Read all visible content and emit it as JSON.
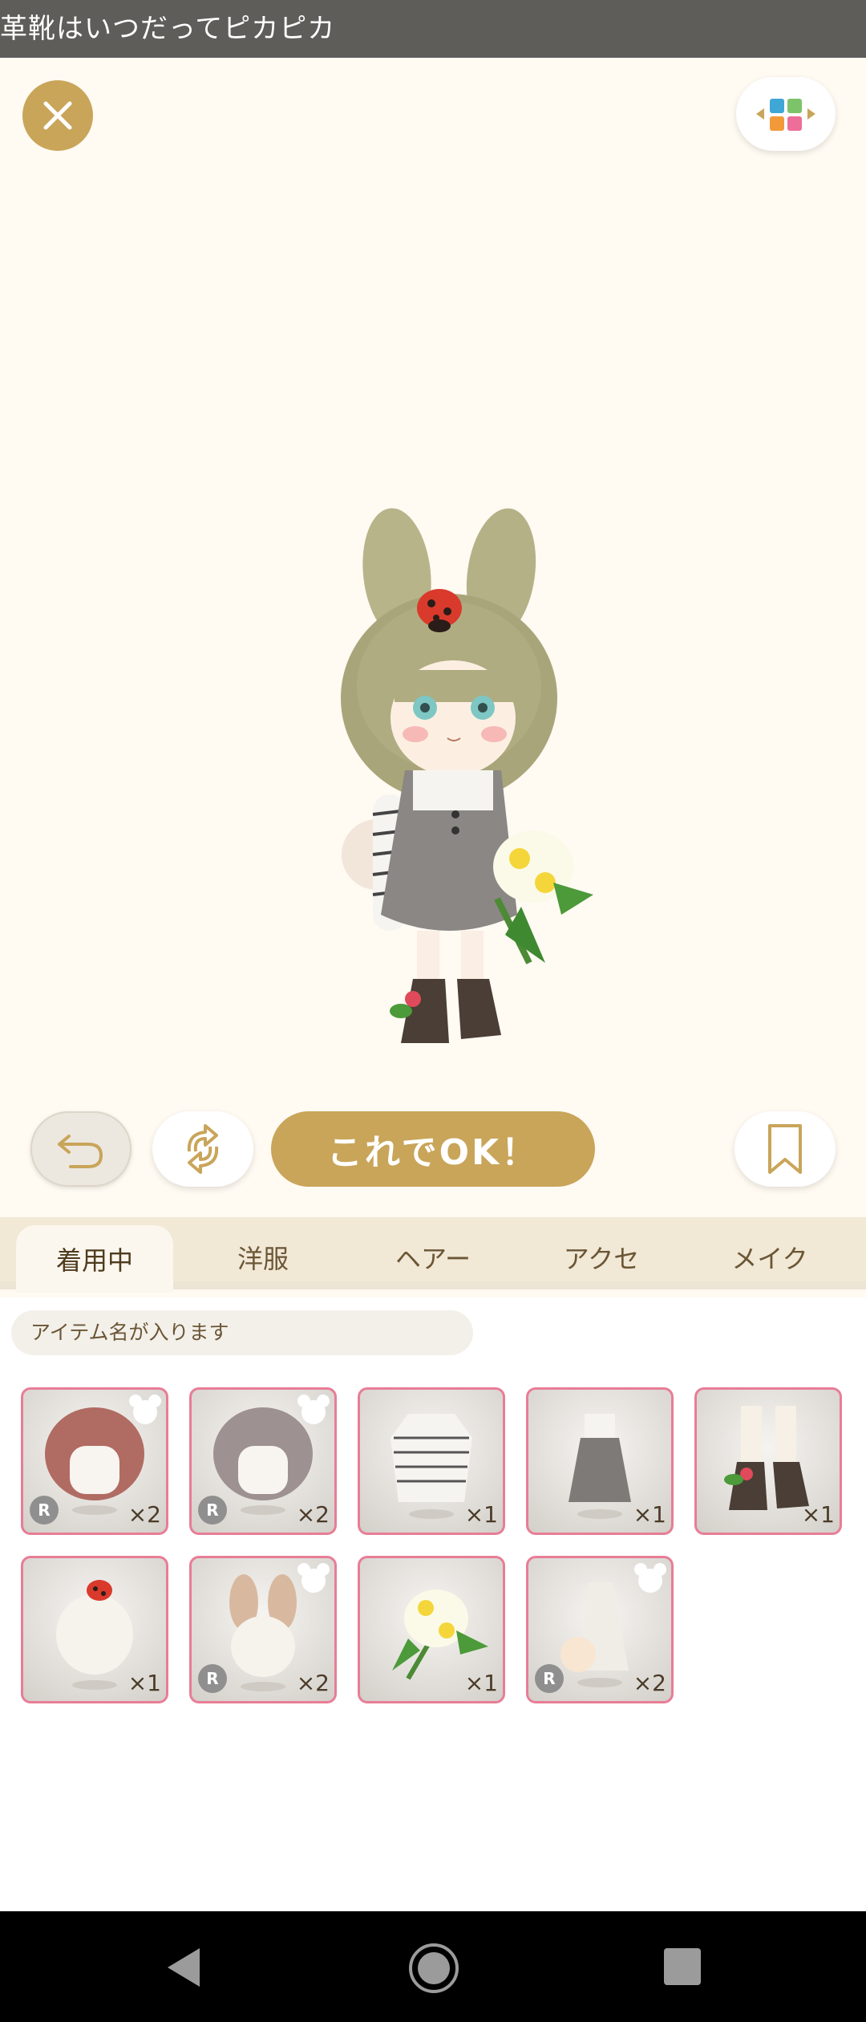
{
  "window": {
    "title": "革靴はいつだってピカピカ"
  },
  "actions": {
    "ok_label": "これでOK！"
  },
  "tabs": [
    {
      "label": "着用中",
      "active": true
    },
    {
      "label": "洋服",
      "active": false
    },
    {
      "label": "ヘアー",
      "active": false
    },
    {
      "label": "アクセ",
      "active": false
    },
    {
      "label": "メイク",
      "active": false
    }
  ],
  "item_name_placeholder": "アイテム名が入ります",
  "items": [
    {
      "name": "hair-red-bob",
      "count": "×2",
      "rarity": "R",
      "bear_badge": true
    },
    {
      "name": "hair-gray-bob",
      "count": "×2",
      "rarity": "R",
      "bear_badge": true
    },
    {
      "name": "striped-shirt",
      "count": "×1",
      "rarity": "",
      "bear_badge": false
    },
    {
      "name": "gray-pinafore-dress",
      "count": "×1",
      "rarity": "",
      "bear_badge": false
    },
    {
      "name": "flower-lace-boots",
      "count": "×1",
      "rarity": "",
      "bear_badge": false
    },
    {
      "name": "ladybug-hair-accessory",
      "count": "×1",
      "rarity": "",
      "bear_badge": false
    },
    {
      "name": "bunny-ears",
      "count": "×2",
      "rarity": "R",
      "bear_badge": true
    },
    {
      "name": "flower-bouquet",
      "count": "×1",
      "rarity": "",
      "bear_badge": false
    },
    {
      "name": "fluffy-tail",
      "count": "×2",
      "rarity": "R",
      "bear_badge": true
    }
  ],
  "colors": {
    "accent_gold": "#c9a55a",
    "item_border_pink": "#e87d96",
    "tab_bar": "#f1e8d6",
    "title_bar": "#5e5d5a"
  },
  "icons": [
    "close-icon",
    "palette-icon",
    "undo-icon",
    "refresh-icon",
    "bookmark-icon",
    "bear-icon",
    "back-icon",
    "home-icon",
    "recent-apps-icon"
  ]
}
